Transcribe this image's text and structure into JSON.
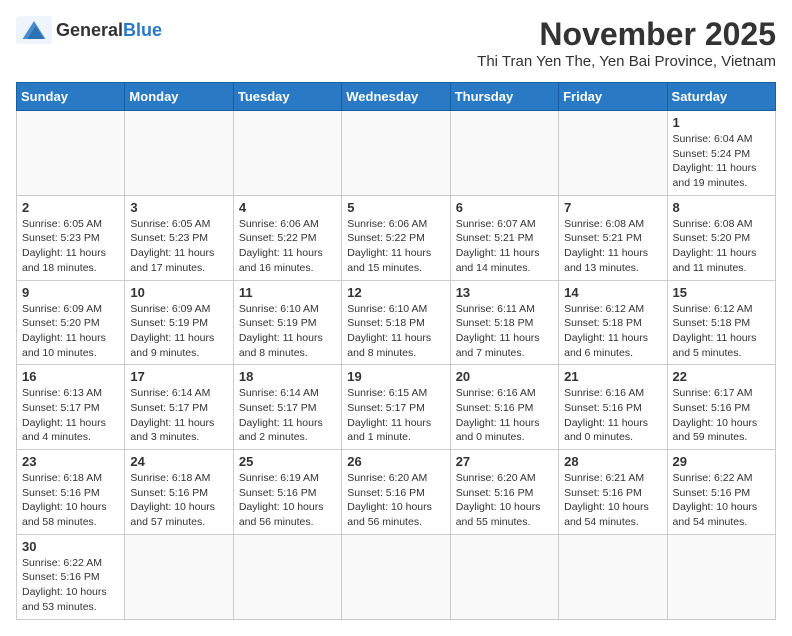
{
  "header": {
    "logo_general": "General",
    "logo_blue": "Blue",
    "month_year": "November 2025",
    "location": "Thi Tran Yen The, Yen Bai Province, Vietnam"
  },
  "weekdays": [
    "Sunday",
    "Monday",
    "Tuesday",
    "Wednesday",
    "Thursday",
    "Friday",
    "Saturday"
  ],
  "days": {
    "day1": {
      "num": "1",
      "info": "Sunrise: 6:04 AM\nSunset: 5:24 PM\nDaylight: 11 hours and 19 minutes."
    },
    "day2": {
      "num": "2",
      "info": "Sunrise: 6:05 AM\nSunset: 5:23 PM\nDaylight: 11 hours and 18 minutes."
    },
    "day3": {
      "num": "3",
      "info": "Sunrise: 6:05 AM\nSunset: 5:23 PM\nDaylight: 11 hours and 17 minutes."
    },
    "day4": {
      "num": "4",
      "info": "Sunrise: 6:06 AM\nSunset: 5:22 PM\nDaylight: 11 hours and 16 minutes."
    },
    "day5": {
      "num": "5",
      "info": "Sunrise: 6:06 AM\nSunset: 5:22 PM\nDaylight: 11 hours and 15 minutes."
    },
    "day6": {
      "num": "6",
      "info": "Sunrise: 6:07 AM\nSunset: 5:21 PM\nDaylight: 11 hours and 14 minutes."
    },
    "day7": {
      "num": "7",
      "info": "Sunrise: 6:08 AM\nSunset: 5:21 PM\nDaylight: 11 hours and 13 minutes."
    },
    "day8": {
      "num": "8",
      "info": "Sunrise: 6:08 AM\nSunset: 5:20 PM\nDaylight: 11 hours and 11 minutes."
    },
    "day9": {
      "num": "9",
      "info": "Sunrise: 6:09 AM\nSunset: 5:20 PM\nDaylight: 11 hours and 10 minutes."
    },
    "day10": {
      "num": "10",
      "info": "Sunrise: 6:09 AM\nSunset: 5:19 PM\nDaylight: 11 hours and 9 minutes."
    },
    "day11": {
      "num": "11",
      "info": "Sunrise: 6:10 AM\nSunset: 5:19 PM\nDaylight: 11 hours and 8 minutes."
    },
    "day12": {
      "num": "12",
      "info": "Sunrise: 6:10 AM\nSunset: 5:18 PM\nDaylight: 11 hours and 8 minutes."
    },
    "day13": {
      "num": "13",
      "info": "Sunrise: 6:11 AM\nSunset: 5:18 PM\nDaylight: 11 hours and 7 minutes."
    },
    "day14": {
      "num": "14",
      "info": "Sunrise: 6:12 AM\nSunset: 5:18 PM\nDaylight: 11 hours and 6 minutes."
    },
    "day15": {
      "num": "15",
      "info": "Sunrise: 6:12 AM\nSunset: 5:18 PM\nDaylight: 11 hours and 5 minutes."
    },
    "day16": {
      "num": "16",
      "info": "Sunrise: 6:13 AM\nSunset: 5:17 PM\nDaylight: 11 hours and 4 minutes."
    },
    "day17": {
      "num": "17",
      "info": "Sunrise: 6:14 AM\nSunset: 5:17 PM\nDaylight: 11 hours and 3 minutes."
    },
    "day18": {
      "num": "18",
      "info": "Sunrise: 6:14 AM\nSunset: 5:17 PM\nDaylight: 11 hours and 2 minutes."
    },
    "day19": {
      "num": "19",
      "info": "Sunrise: 6:15 AM\nSunset: 5:17 PM\nDaylight: 11 hours and 1 minute."
    },
    "day20": {
      "num": "20",
      "info": "Sunrise: 6:16 AM\nSunset: 5:16 PM\nDaylight: 11 hours and 0 minutes."
    },
    "day21": {
      "num": "21",
      "info": "Sunrise: 6:16 AM\nSunset: 5:16 PM\nDaylight: 11 hours and 0 minutes."
    },
    "day22": {
      "num": "22",
      "info": "Sunrise: 6:17 AM\nSunset: 5:16 PM\nDaylight: 10 hours and 59 minutes."
    },
    "day23": {
      "num": "23",
      "info": "Sunrise: 6:18 AM\nSunset: 5:16 PM\nDaylight: 10 hours and 58 minutes."
    },
    "day24": {
      "num": "24",
      "info": "Sunrise: 6:18 AM\nSunset: 5:16 PM\nDaylight: 10 hours and 57 minutes."
    },
    "day25": {
      "num": "25",
      "info": "Sunrise: 6:19 AM\nSunset: 5:16 PM\nDaylight: 10 hours and 56 minutes."
    },
    "day26": {
      "num": "26",
      "info": "Sunrise: 6:20 AM\nSunset: 5:16 PM\nDaylight: 10 hours and 56 minutes."
    },
    "day27": {
      "num": "27",
      "info": "Sunrise: 6:20 AM\nSunset: 5:16 PM\nDaylight: 10 hours and 55 minutes."
    },
    "day28": {
      "num": "28",
      "info": "Sunrise: 6:21 AM\nSunset: 5:16 PM\nDaylight: 10 hours and 54 minutes."
    },
    "day29": {
      "num": "29",
      "info": "Sunrise: 6:22 AM\nSunset: 5:16 PM\nDaylight: 10 hours and 54 minutes."
    },
    "day30": {
      "num": "30",
      "info": "Sunrise: 6:22 AM\nSunset: 5:16 PM\nDaylight: 10 hours and 53 minutes."
    }
  }
}
